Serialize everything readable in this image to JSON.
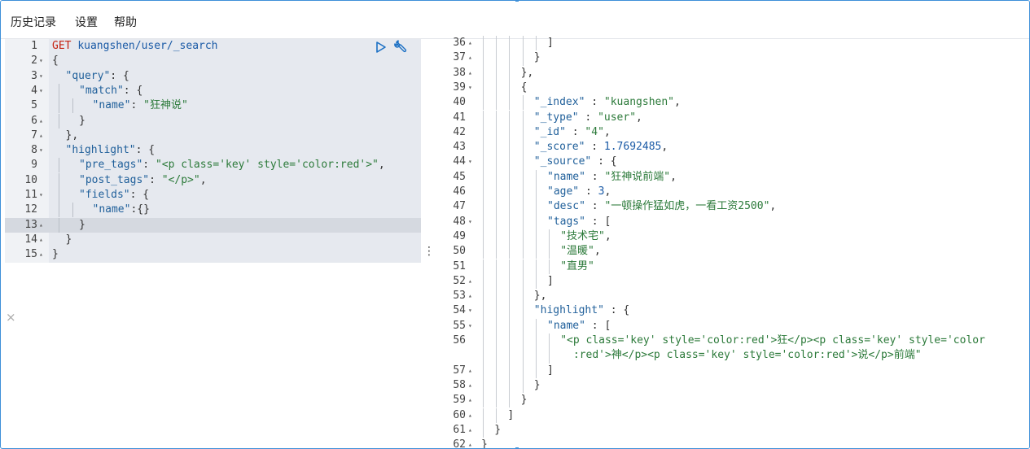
{
  "menu": {
    "history": "历史记录",
    "settings": "设置",
    "help": "帮助"
  },
  "request": {
    "lines": [
      {
        "n": "1",
        "fold": "",
        "indent": 0,
        "html": "<span class='kw'>GET</span> <span class='url'>kuangshen/user/_search</span>"
      },
      {
        "n": "2",
        "fold": "▾",
        "indent": 0,
        "html": "<span class='pun'>{</span>"
      },
      {
        "n": "3",
        "fold": "▾",
        "indent": 1,
        "html": "<span class='key'>\"query\"</span><span class='pun'>: {</span>"
      },
      {
        "n": "4",
        "fold": "▾",
        "indent": 2,
        "html": "<span class='key'>\"match\"</span><span class='pun'>: {</span>"
      },
      {
        "n": "5",
        "fold": "",
        "indent": 3,
        "html": "<span class='key'>\"name\"</span><span class='pun'>: </span><span class='str'>\"狂神说\"</span>"
      },
      {
        "n": "6",
        "fold": "▴",
        "indent": 2,
        "html": "<span class='pun'>}</span>"
      },
      {
        "n": "7",
        "fold": "▴",
        "indent": 1,
        "html": "<span class='pun'>},</span>"
      },
      {
        "n": "8",
        "fold": "▾",
        "indent": 1,
        "html": "<span class='key'>\"highlight\"</span><span class='pun'>: {</span>"
      },
      {
        "n": "9",
        "fold": "",
        "indent": 2,
        "html": "<span class='key'>\"pre_tags\"</span><span class='pun'>: </span><span class='str'>\"&lt;p class='key' style='color:red'&gt;\"</span><span class='pun'>,</span>"
      },
      {
        "n": "10",
        "fold": "",
        "indent": 2,
        "html": "<span class='key'>\"post_tags\"</span><span class='pun'>: </span><span class='str'>\"&lt;/p&gt;\"</span><span class='pun'>,</span>"
      },
      {
        "n": "11",
        "fold": "▾",
        "indent": 2,
        "html": "<span class='key'>\"fields\"</span><span class='pun'>: {</span>"
      },
      {
        "n": "12",
        "fold": "",
        "indent": 3,
        "html": "<span class='key'>\"name\"</span><span class='pun'>:{}</span>"
      },
      {
        "n": "13",
        "fold": "▴",
        "indent": 2,
        "html": "<span class='pun'>}</span>"
      },
      {
        "n": "14",
        "fold": "▴",
        "indent": 1,
        "html": "<span class='pun'>}</span>"
      },
      {
        "n": "15",
        "fold": "▴",
        "indent": 0,
        "html": "<span class='pun'>}</span>"
      }
    ]
  },
  "response": {
    "lines": [
      {
        "n": "36",
        "fold": "▴",
        "indent": 5,
        "html": "<span class='pun'>]</span>"
      },
      {
        "n": "37",
        "fold": "▴",
        "indent": 4,
        "html": "<span class='pun'>}</span>"
      },
      {
        "n": "38",
        "fold": "▴",
        "indent": 3,
        "html": "<span class='pun'>},</span>"
      },
      {
        "n": "39",
        "fold": "▾",
        "indent": 3,
        "html": "<span class='pun'>{</span>"
      },
      {
        "n": "40",
        "fold": "",
        "indent": 4,
        "html": "<span class='key'>\"_index\"</span><span class='pun'> : </span><span class='str'>\"kuangshen\"</span><span class='pun'>,</span>"
      },
      {
        "n": "41",
        "fold": "",
        "indent": 4,
        "html": "<span class='key'>\"_type\"</span><span class='pun'> : </span><span class='str'>\"user\"</span><span class='pun'>,</span>"
      },
      {
        "n": "42",
        "fold": "",
        "indent": 4,
        "html": "<span class='key'>\"_id\"</span><span class='pun'> : </span><span class='str'>\"4\"</span><span class='pun'>,</span>"
      },
      {
        "n": "43",
        "fold": "",
        "indent": 4,
        "html": "<span class='key'>\"_score\"</span><span class='pun'> : </span><span class='url'>1.7692485</span><span class='pun'>,</span>"
      },
      {
        "n": "44",
        "fold": "▾",
        "indent": 4,
        "html": "<span class='key'>\"_source\"</span><span class='pun'> : {</span>"
      },
      {
        "n": "45",
        "fold": "",
        "indent": 5,
        "html": "<span class='key'>\"name\"</span><span class='pun'> : </span><span class='str'>\"狂神说前端\"</span><span class='pun'>,</span>"
      },
      {
        "n": "46",
        "fold": "",
        "indent": 5,
        "html": "<span class='key'>\"age\"</span><span class='pun'> : </span><span class='url'>3</span><span class='pun'>,</span>"
      },
      {
        "n": "47",
        "fold": "",
        "indent": 5,
        "html": "<span class='key'>\"desc\"</span><span class='pun'> : </span><span class='str'>\"一顿操作猛如虎，一看工资2500\"</span><span class='pun'>,</span>"
      },
      {
        "n": "48",
        "fold": "▾",
        "indent": 5,
        "html": "<span class='key'>\"tags\"</span><span class='pun'> : [</span>"
      },
      {
        "n": "49",
        "fold": "",
        "indent": 6,
        "html": "<span class='str'>\"技术宅\"</span><span class='pun'>,</span>"
      },
      {
        "n": "50",
        "fold": "",
        "indent": 6,
        "html": "<span class='str'>\"温暖\"</span><span class='pun'>,</span>"
      },
      {
        "n": "51",
        "fold": "",
        "indent": 6,
        "html": "<span class='str'>\"直男\"</span>"
      },
      {
        "n": "52",
        "fold": "▴",
        "indent": 5,
        "html": "<span class='pun'>]</span>"
      },
      {
        "n": "53",
        "fold": "▴",
        "indent": 4,
        "html": "<span class='pun'>},</span>"
      },
      {
        "n": "54",
        "fold": "▾",
        "indent": 4,
        "html": "<span class='key'>\"highlight\"</span><span class='pun'> : {</span>"
      },
      {
        "n": "55",
        "fold": "▾",
        "indent": 5,
        "html": "<span class='key'>\"name\"</span><span class='pun'> : [</span>"
      },
      {
        "n": "56",
        "fold": "",
        "indent": 6,
        "html": "<span class='str'>\"&lt;p class='key' style='color:red'&gt;狂&lt;/p&gt;&lt;p class='key' style='color</span>"
      },
      {
        "n": "",
        "fold": "",
        "indent": 6,
        "html": "<span class='str'>  :red'&gt;神&lt;/p&gt;&lt;p class='key' style='color:red'&gt;说&lt;/p&gt;前端\"</span>"
      },
      {
        "n": "57",
        "fold": "▴",
        "indent": 5,
        "html": "<span class='pun'>]</span>"
      },
      {
        "n": "58",
        "fold": "▴",
        "indent": 4,
        "html": "<span class='pun'>}</span>"
      },
      {
        "n": "59",
        "fold": "▴",
        "indent": 3,
        "html": "<span class='pun'>}</span>"
      },
      {
        "n": "60",
        "fold": "▴",
        "indent": 2,
        "html": "<span class='pun'>]</span>"
      },
      {
        "n": "61",
        "fold": "▴",
        "indent": 1,
        "html": "<span class='pun'>}</span>"
      },
      {
        "n": "62",
        "fold": "▴",
        "indent": 0,
        "html": "<span class='pun'>}</span>"
      }
    ]
  },
  "misc": {
    "close_symbol": "×",
    "dots": "⋮"
  }
}
